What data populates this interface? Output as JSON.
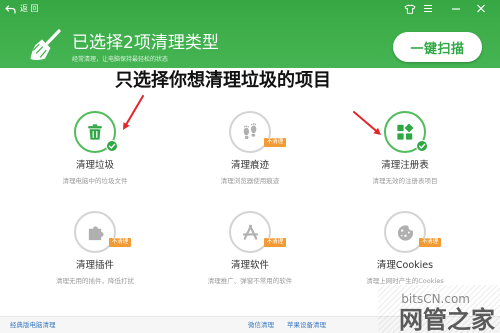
{
  "window": {
    "back_icon": "back-arrow-icon",
    "back_label": "返 回",
    "control_icons": [
      "skin-icon",
      "menu-icon",
      "minimize-icon",
      "close-icon"
    ]
  },
  "header": {
    "icon": "broom-icon",
    "title": "已选择2项清理类型",
    "subtitle": "经常清理，让电脑保持最轻松的状态",
    "scan_button": "一键扫描"
  },
  "annotation": {
    "text": "只选择你想清理垃圾的项目"
  },
  "items": [
    {
      "icon": "trash-icon",
      "label": "清理垃圾",
      "desc": "清理电脑中的垃圾文件",
      "selected": true
    },
    {
      "icon": "footprints-icon",
      "label": "清理痕迹",
      "desc": "清理浏览器使用痕迹",
      "selected": false,
      "badge": "不清理"
    },
    {
      "icon": "registry-icon",
      "label": "清理注册表",
      "desc": "清理无效的注册表项目",
      "selected": true
    },
    {
      "icon": "puzzle-icon",
      "label": "清理插件",
      "desc": "清理无用的插件，降低打扰",
      "selected": false,
      "badge": "不清理"
    },
    {
      "icon": "app-icon",
      "label": "清理软件",
      "desc": "清理推广、弹窗不常用的软件",
      "selected": false,
      "badge": "不清理"
    },
    {
      "icon": "cookie-icon",
      "label": "清理Cookies",
      "desc": "清理上网时产生的Cookies",
      "selected": false,
      "badge": "不清理"
    }
  ],
  "footer": {
    "classic_link": "经典版电脑清理",
    "wechat_link": "微信清理",
    "apple_link": "苹果设备清理"
  },
  "watermark": {
    "site": "bitsCN.com",
    "name": "网管之家"
  },
  "colors": {
    "header_green": "#3dad4a",
    "accent_green": "#2fa744",
    "selected_border": "#52bc5c",
    "unselected_border": "#d4d4d4",
    "badge_orange": "#f29b34",
    "arrow_red": "#e3262b",
    "link_blue": "#3a79c2"
  }
}
